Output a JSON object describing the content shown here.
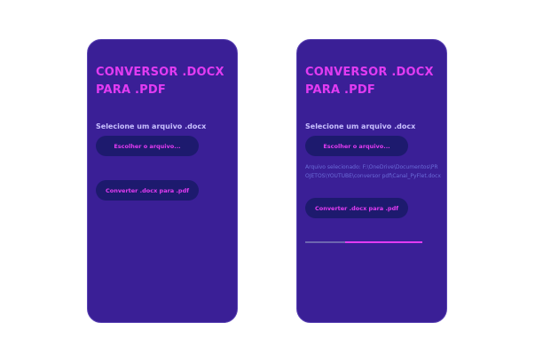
{
  "app": {
    "title": "CONVERSOR .DOCX PARA .PDF",
    "accent_color": "#e23bf2",
    "background_color": "#3a1f96",
    "button_color": "#1d1a6e"
  },
  "screens": [
    {
      "label": "Selecione um arquivo .docx",
      "choose_button": "Escolher o arquivo...",
      "convert_button": "Converter .docx para .pdf"
    },
    {
      "label": "Selecione um arquivo .docx",
      "choose_button": "Escolher o arquivo...",
      "selected_file": "Arquivo selecionado: F:\\OneDrive\\Documentos\\PROJETOS\\YOUTUBE\\conversor pdf\\Canal_PyFlet.docx",
      "convert_button": "Converter .docx para .pdf",
      "progress": {
        "value": 0.66
      }
    }
  ]
}
